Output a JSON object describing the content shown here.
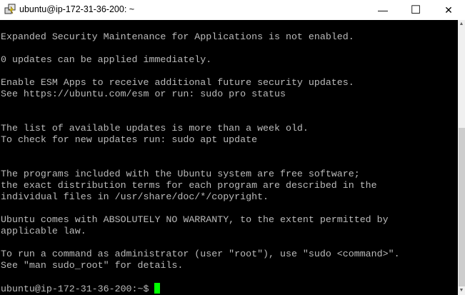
{
  "window": {
    "title": "ubuntu@ip-172-31-36-200: ~",
    "minimize": "—",
    "maximize": "☐",
    "close": "✕"
  },
  "terminal": {
    "lines": [
      "Expanded Security Maintenance for Applications is not enabled.",
      "",
      "0 updates can be applied immediately.",
      "",
      "Enable ESM Apps to receive additional future security updates.",
      "See https://ubuntu.com/esm or run: sudo pro status",
      "",
      "",
      "The list of available updates is more than a week old.",
      "To check for new updates run: sudo apt update",
      "",
      "",
      "The programs included with the Ubuntu system are free software;",
      "the exact distribution terms for each program are described in the",
      "individual files in /usr/share/doc/*/copyright.",
      "",
      "Ubuntu comes with ABSOLUTELY NO WARRANTY, to the extent permitted by",
      "applicable law.",
      "",
      "To run a command as administrator (user \"root\"), use \"sudo <command>\".",
      "See \"man sudo_root\" for details.",
      ""
    ],
    "prompt": "ubuntu@ip-172-31-36-200:~$ ",
    "scroll_position_percent": 100
  }
}
